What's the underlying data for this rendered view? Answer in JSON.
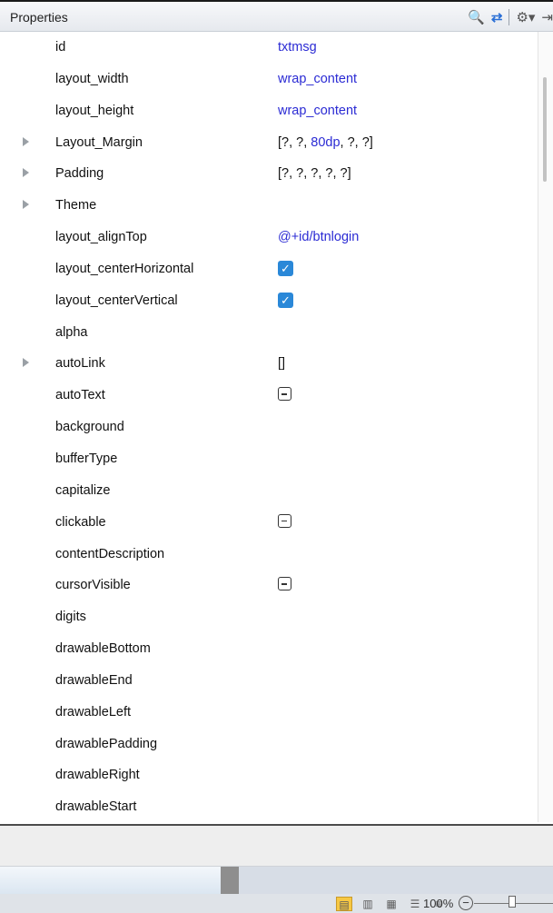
{
  "header": {
    "title": "Properties",
    "search_icon_glyph": "🔍",
    "swap_icon_glyph": "⇄",
    "gear_icon_glyph": "⚙▾",
    "pin_icon_glyph": "⇥"
  },
  "rows": [
    {
      "name": "id",
      "value": "txtmsg",
      "value_color": "blue"
    },
    {
      "name": "layout_width",
      "value": "wrap_content",
      "value_color": "blue"
    },
    {
      "name": "layout_height",
      "value": "wrap_content",
      "value_color": "blue"
    },
    {
      "name": "Layout_Margin",
      "expandable": true,
      "value_parts": [
        "[?, ?, ",
        "80dp",
        ", ?, ?]"
      ]
    },
    {
      "name": "Padding",
      "expandable": true,
      "value": "[?, ?, ?, ?, ?]"
    },
    {
      "name": "Theme",
      "expandable": true,
      "value": ""
    },
    {
      "name": "layout_alignTop",
      "value": "@+id/btnlogin",
      "value_color": "blue"
    },
    {
      "name": "layout_centerHorizontal",
      "control": "checked"
    },
    {
      "name": "layout_centerVertical",
      "control": "checked"
    },
    {
      "name": "alpha",
      "value": ""
    },
    {
      "name": "autoLink",
      "expandable": true,
      "value": "[]"
    },
    {
      "name": "autoText",
      "control": "indeterminate"
    },
    {
      "name": "background",
      "value": ""
    },
    {
      "name": "bufferType",
      "value": ""
    },
    {
      "name": "capitalize",
      "value": ""
    },
    {
      "name": "clickable",
      "control": "indeterminate"
    },
    {
      "name": "contentDescription",
      "value": ""
    },
    {
      "name": "cursorVisible",
      "control": "indeterminate"
    },
    {
      "name": "digits",
      "value": ""
    },
    {
      "name": "drawableBottom",
      "value": ""
    },
    {
      "name": "drawableEnd",
      "value": ""
    },
    {
      "name": "drawableLeft",
      "value": ""
    },
    {
      "name": "drawablePadding",
      "value": ""
    },
    {
      "name": "drawableRight",
      "value": ""
    },
    {
      "name": "drawableStart",
      "value": ""
    }
  ],
  "statusbar": {
    "zoom_label": "100%",
    "zoom_level": 1.0,
    "zoom_minus_glyph": "−",
    "view_buttons": [
      "▤",
      "▥",
      "▦",
      "☰",
      "≡"
    ]
  },
  "colors": {
    "blue_text": "#2b2bd4",
    "checkbox": "#2a88d8",
    "active_view": "#f7c843"
  }
}
